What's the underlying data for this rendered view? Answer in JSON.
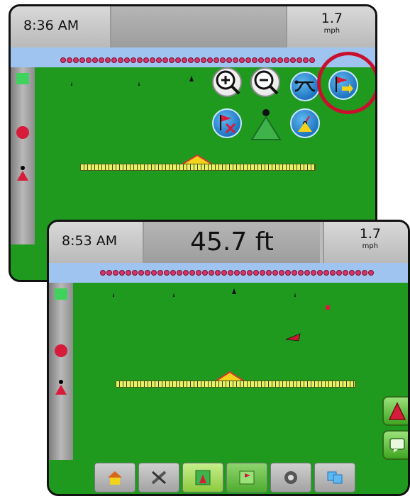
{
  "screen1": {
    "time": "8:36 AM",
    "speed_value": "1.7",
    "speed_unit": "mph",
    "map_buttons": [
      "zoom-in",
      "zoom-out",
      "guidance-mode",
      "return-to-point",
      "delete-point",
      "vehicle-view",
      "perspective-view"
    ]
  },
  "screen2": {
    "time": "8:53 AM",
    "distance": "45.7 ft",
    "speed_value": "1.7",
    "speed_unit": "mph",
    "bottom_nav": [
      "home",
      "setup",
      "guidance",
      "mapping",
      "settings",
      "data"
    ]
  },
  "colors": {
    "field": "#1f9a1f",
    "sky": "#9fc4ef",
    "highlight": "#c8102e",
    "button": "#1f74c0"
  }
}
